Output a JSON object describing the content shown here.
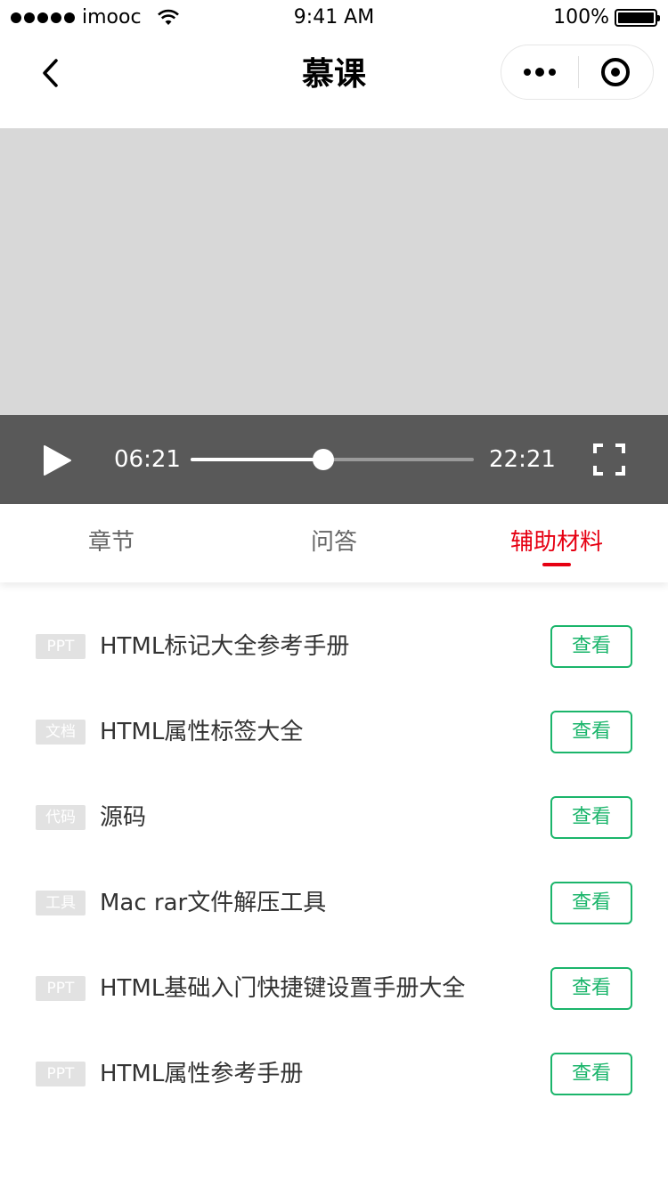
{
  "status_bar": {
    "carrier": "imooc",
    "time": "9:41 AM",
    "battery": "100%"
  },
  "nav": {
    "title": "慕课",
    "back_icon": "chevron-left-icon",
    "more_icon": "more-dots-icon",
    "close_icon": "target-close-icon"
  },
  "player": {
    "current_time": "06:21",
    "total_time": "22:21",
    "progress": 0.47,
    "play_icon": "play-icon",
    "fullscreen_icon": "fullscreen-icon"
  },
  "tabs": [
    {
      "label": "章节",
      "active": false
    },
    {
      "label": "问答",
      "active": false
    },
    {
      "label": "辅助材料",
      "active": true
    }
  ],
  "materials": [
    {
      "tag": "PPT",
      "title": "HTML标记大全参考手册",
      "action": "查看"
    },
    {
      "tag": "文档",
      "title": "HTML属性标签大全",
      "action": "查看"
    },
    {
      "tag": "代码",
      "title": "源码",
      "action": "查看"
    },
    {
      "tag": "工具",
      "title": "Mac rar文件解压工具",
      "action": "查看"
    },
    {
      "tag": "PPT",
      "title": "HTML基础入门快捷键设置手册大全",
      "action": "查看"
    },
    {
      "tag": "PPT",
      "title": "HTML属性参考手册",
      "action": "查看"
    }
  ],
  "colors": {
    "accent_red": "#e60012",
    "action_green": "#1bb56b",
    "video_bg": "#d8d8d8",
    "controls_bg": "#595959",
    "tag_bg": "#e2e2e2"
  }
}
